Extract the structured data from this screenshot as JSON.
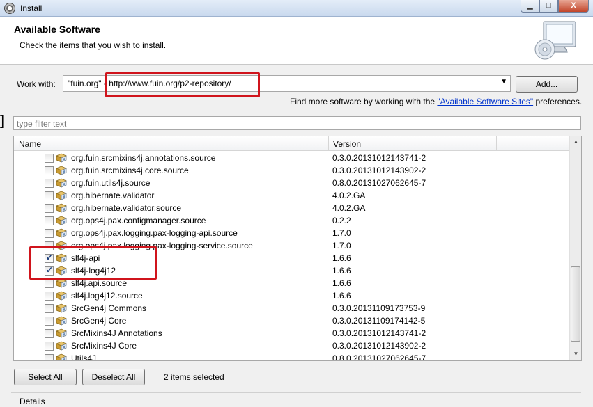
{
  "window": {
    "title": "Install",
    "controls": {
      "minimize": "▁",
      "maximize": "□",
      "close": "X"
    }
  },
  "banner": {
    "title": "Available Software",
    "description": "Check the items that you wish to install."
  },
  "work_with": {
    "label": "Work with:",
    "value": "\"fuin.org\" - http://www.fuin.org/p2-repository/",
    "add_label": "Add...",
    "find_more_prefix": "Find more software by working with the ",
    "find_more_link": "\"Available Software Sites\"",
    "find_more_suffix": " preferences."
  },
  "filter": {
    "placeholder": "type filter text"
  },
  "table": {
    "columns": [
      "Name",
      "Version"
    ],
    "rows": [
      {
        "name": "org.fuin.srcmixins4j.annotations.source",
        "version": "0.3.0.20131012143741-2",
        "checked": false
      },
      {
        "name": "org.fuin.srcmixins4j.core.source",
        "version": "0.3.0.20131012143902-2",
        "checked": false
      },
      {
        "name": "org.fuin.utils4j.source",
        "version": "0.8.0.20131027062645-7",
        "checked": false
      },
      {
        "name": "org.hibernate.validator",
        "version": "4.0.2.GA",
        "checked": false
      },
      {
        "name": "org.hibernate.validator.source",
        "version": "4.0.2.GA",
        "checked": false
      },
      {
        "name": "org.ops4j.pax.configmanager.source",
        "version": "0.2.2",
        "checked": false
      },
      {
        "name": "org.ops4j.pax.logging.pax-logging-api.source",
        "version": "1.7.0",
        "checked": false
      },
      {
        "name": "org.ops4j.pax.logging.pax-logging-service.source",
        "version": "1.7.0",
        "checked": false
      },
      {
        "name": "slf4j-api",
        "version": "1.6.6",
        "checked": true
      },
      {
        "name": "slf4j-log4j12",
        "version": "1.6.6",
        "checked": true
      },
      {
        "name": "slf4j.api.source",
        "version": "1.6.6",
        "checked": false
      },
      {
        "name": "slf4j.log4j12.source",
        "version": "1.6.6",
        "checked": false
      },
      {
        "name": "SrcGen4j Commons",
        "version": "0.3.0.20131109173753-9",
        "checked": false
      },
      {
        "name": "SrcGen4j Core",
        "version": "0.3.0.20131109174142-5",
        "checked": false
      },
      {
        "name": "SrcMixins4J Annotations",
        "version": "0.3.0.20131012143741-2",
        "checked": false
      },
      {
        "name": "SrcMixins4J Core",
        "version": "0.3.0.20131012143902-2",
        "checked": false
      },
      {
        "name": "Utils4J",
        "version": "0.8.0.20131027062645-7",
        "checked": false
      }
    ]
  },
  "footer": {
    "select_all": "Select All",
    "deselect_all": "Deselect All",
    "selection_status": "2 items selected",
    "details": "Details"
  },
  "icons": {
    "app": "eclipse-icon",
    "banner": "install-cd-monitor-icon",
    "row": "plugin-feature-icon"
  },
  "colors": {
    "annotation": "#d0141c",
    "link": "#0033cc"
  }
}
